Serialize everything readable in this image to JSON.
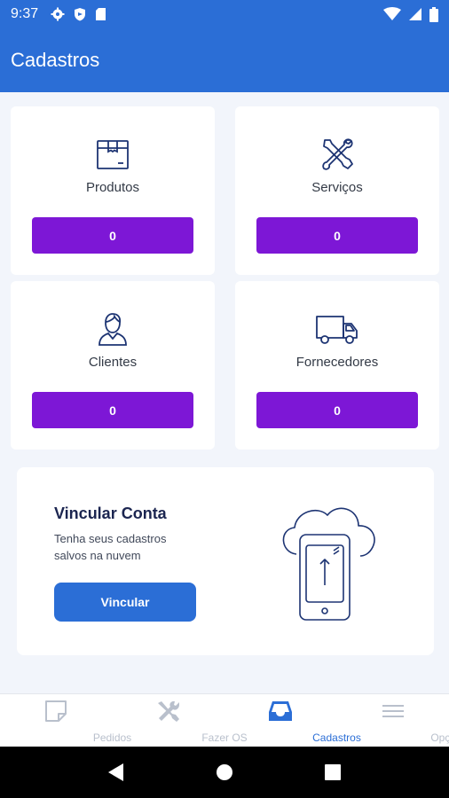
{
  "status_bar": {
    "time": "9:37",
    "left_icons": [
      "gear-icon",
      "shield-icon",
      "sd-card-icon"
    ],
    "right_icons": [
      "wifi-icon",
      "signal-icon",
      "battery-icon"
    ]
  },
  "app_bar": {
    "title": "Cadastros"
  },
  "cards": [
    {
      "label": "Produtos",
      "count": "0",
      "icon": "box-icon"
    },
    {
      "label": "Serviços",
      "count": "0",
      "icon": "tools-icon"
    },
    {
      "label": "Clientes",
      "count": "0",
      "icon": "person-icon"
    },
    {
      "label": "Fornecedores",
      "count": "0",
      "icon": "truck-icon"
    }
  ],
  "promo": {
    "title": "Vincular Conta",
    "description": "Tenha seus cadastros salvos na nuvem",
    "button_label": "Vincular",
    "illustration": "cloud-phone-upload-icon"
  },
  "bottom_nav": {
    "items": [
      {
        "label": "Pedidos",
        "icon": "note-icon",
        "active": false
      },
      {
        "label": "Fazer OS",
        "icon": "tools-icon",
        "active": false
      },
      {
        "label": "Cadastros",
        "icon": "inbox-icon",
        "active": true
      },
      {
        "label": "Opções",
        "icon": "menu-icon",
        "active": false
      }
    ]
  },
  "system_nav": {
    "icons": [
      "back-icon",
      "home-icon",
      "recents-icon"
    ]
  },
  "colors": {
    "primary": "#2b6ed6",
    "counter": "#7d17d6",
    "icon": "#1d3473",
    "inactive": "#b9c0cc"
  }
}
